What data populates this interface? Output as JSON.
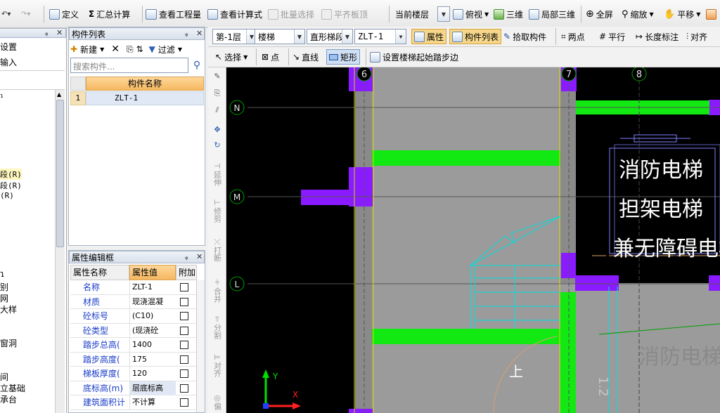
{
  "toolbar1": {
    "define": "定义",
    "summary": "汇总计算",
    "view_qty": "查看工程量",
    "view_formula": "查看计算式",
    "batch_select": "批量选择",
    "align_slab": "平齐板顶",
    "current_floor": "当前楼层",
    "top_view": "俯视",
    "three_d": "三维",
    "partial_3d": "局部三维",
    "full_screen": "全屏",
    "zoom": "缩放",
    "pan": "平移"
  },
  "toolbar2": {
    "floor": "第-1层",
    "category": "楼梯",
    "subtype": "直形梯段",
    "component": "ZLT-1",
    "properties": "属性",
    "component_list": "构件列表",
    "pick": "拾取构件",
    "two_points": "两点",
    "parallel": "平行",
    "length_dim": "长度标注",
    "align": "对齐"
  },
  "toolbar3": {
    "select": "选择",
    "point": "点",
    "line": "直线",
    "rect": "矩形",
    "set_start": "设置楼梯起始踏步边"
  },
  "left_panel": {
    "item1": "设置",
    "item2": "输入",
    "item3": "段(R)",
    "item4": "段(R)",
    "item5": "(R)",
    "item6": "别",
    "item7": "网",
    "item8": "大样",
    "item9": "窗洞",
    "item10": "间",
    "item11": "立基础",
    "item12": "承台"
  },
  "component_list": {
    "title": "构件列表",
    "new": "新建",
    "filter": "过滤",
    "search_placeholder": "搜索构件...",
    "column": "构件名称",
    "rows": [
      {
        "index": "1",
        "name": "ZLT-1"
      }
    ]
  },
  "property_editor": {
    "title": "属性编辑框",
    "headers": [
      "属性名称",
      "属性值",
      "附加"
    ],
    "rows": [
      {
        "name": "名称",
        "value": "ZLT-1"
      },
      {
        "name": "材质",
        "value": "现浇混凝"
      },
      {
        "name": "砼标号",
        "value": "(C10)"
      },
      {
        "name": "砼类型",
        "value": "(现浇砼"
      },
      {
        "name": "踏步总高(",
        "value": "1400"
      },
      {
        "name": "踏步高度(",
        "value": "175"
      },
      {
        "name": "梯板厚度(",
        "value": "120"
      },
      {
        "name": "底标高(m)",
        "value": "层底标高"
      },
      {
        "name": "建筑面积计",
        "value": "不计算"
      }
    ]
  },
  "vertical_tools": {
    "extend": "延伸",
    "trim": "修剪",
    "break": "打断",
    "merge": "合并",
    "split": "分割",
    "align": "对齐",
    "edit": "偏"
  },
  "canvas": {
    "axis_labels": [
      "6",
      "7",
      "8",
      "N",
      "M",
      "L"
    ],
    "elevator_text": [
      "消防电梯",
      "担架电梯",
      "兼无障碍电梯"
    ],
    "ghost_text": "消防电梯",
    "up_label": "上",
    "axis_y": "Y",
    "axis_x": "X",
    "dim_text": "1.2"
  }
}
